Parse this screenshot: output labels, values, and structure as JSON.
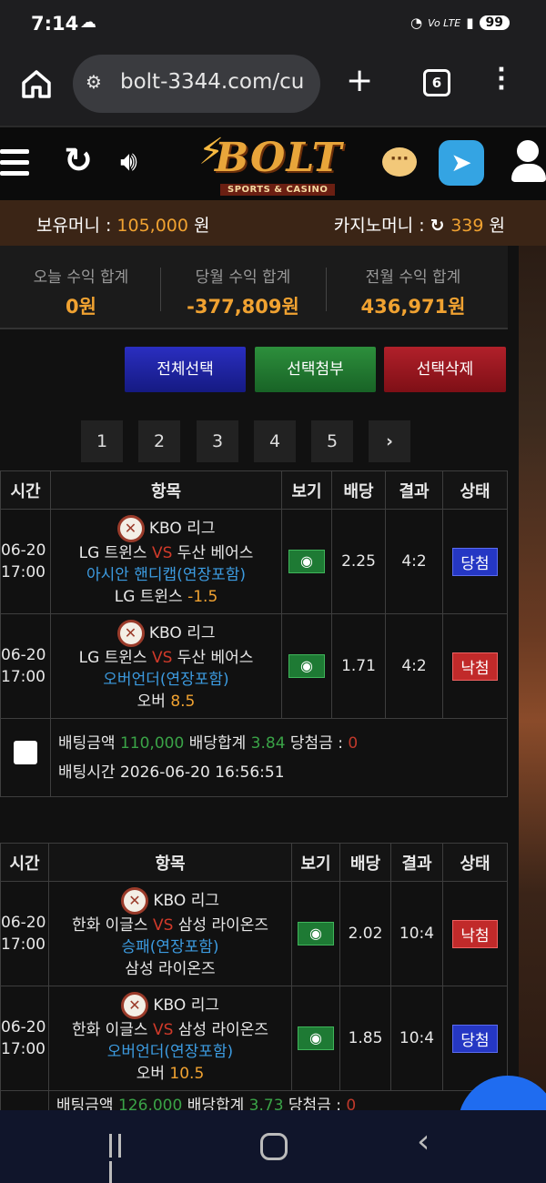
{
  "status_bar": {
    "time": "7:14",
    "network_label": "Vo LTE",
    "battery": "99"
  },
  "browser": {
    "url": "bolt-3344.com/cu",
    "tab_count": "6"
  },
  "site": {
    "logo_text": "BOLT",
    "logo_sub": "SPORTS & CASINO"
  },
  "balance": {
    "money_label": "보유머니 : ",
    "money_value": "105,000",
    "money_unit": " 원",
    "casino_label": "카지노머니 : ",
    "casino_value": "339",
    "casino_unit": " 원"
  },
  "summary": [
    {
      "label": "오늘 수익 합계",
      "value": "0원"
    },
    {
      "label": "당월 수익 합계",
      "value": "-377,809원"
    },
    {
      "label": "전월 수익 합계",
      "value": "436,971원"
    }
  ],
  "actions": {
    "select_all": "전체선택",
    "attach": "선택첨부",
    "delete": "선택삭제"
  },
  "pagination": {
    "pages": [
      "1",
      "2",
      "3",
      "4",
      "5"
    ],
    "next": "›"
  },
  "table_headers": {
    "time": "시간",
    "item": "항목",
    "view": "보기",
    "odds": "배당",
    "result": "결과",
    "state": "상태"
  },
  "bets": [
    {
      "rows": [
        {
          "date": "06-20",
          "time": "17:00",
          "league": "KBO 리그",
          "home": "LG 트윈스",
          "vs": "VS",
          "away": "두산 베어스",
          "market": "아시안 핸디캡(연장포함)",
          "pick": "LG 트윈스",
          "pick_value": "-1.5",
          "odds": "2.25",
          "result": "4:2",
          "state": "당첨"
        },
        {
          "date": "06-20",
          "time": "17:00",
          "league": "KBO 리그",
          "home": "LG 트윈스",
          "vs": "VS",
          "away": "두산 베어스",
          "market": "오버언더(연장포함)",
          "pick": "오버",
          "pick_value": "8.5",
          "odds": "1.71",
          "result": "4:2",
          "state": "낙첨"
        }
      ],
      "amount_label": "배팅금액",
      "amount": "110,000",
      "total_odds_label": "배당합계",
      "total_odds": "3.84",
      "win_label": "당첨금 : ",
      "win": "0",
      "time_label": "배팅시간",
      "bet_time": "2026-06-20 16:56:51"
    },
    {
      "rows": [
        {
          "date": "06-20",
          "time": "17:00",
          "league": "KBO 리그",
          "home": "한화 이글스",
          "vs": "VS",
          "away": "삼성 라이온즈",
          "market": "승패(연장포함)",
          "pick": "삼성 라이온즈",
          "pick_value": "",
          "odds": "2.02",
          "result": "10:4",
          "state": "낙첨"
        },
        {
          "date": "06-20",
          "time": "17:00",
          "league": "KBO 리그",
          "home": "한화 이글스",
          "vs": "VS",
          "away": "삼성 라이온즈",
          "market": "오버언더(연장포함)",
          "pick": "오버",
          "pick_value": "10.5",
          "odds": "1.85",
          "result": "10:4",
          "state": "당첨"
        }
      ],
      "amount_label": "배팅금액",
      "amount": "126,000",
      "total_odds_label": "배당합계",
      "total_odds": "3.73",
      "win_label": "당첨금 : ",
      "win": "0"
    }
  ]
}
